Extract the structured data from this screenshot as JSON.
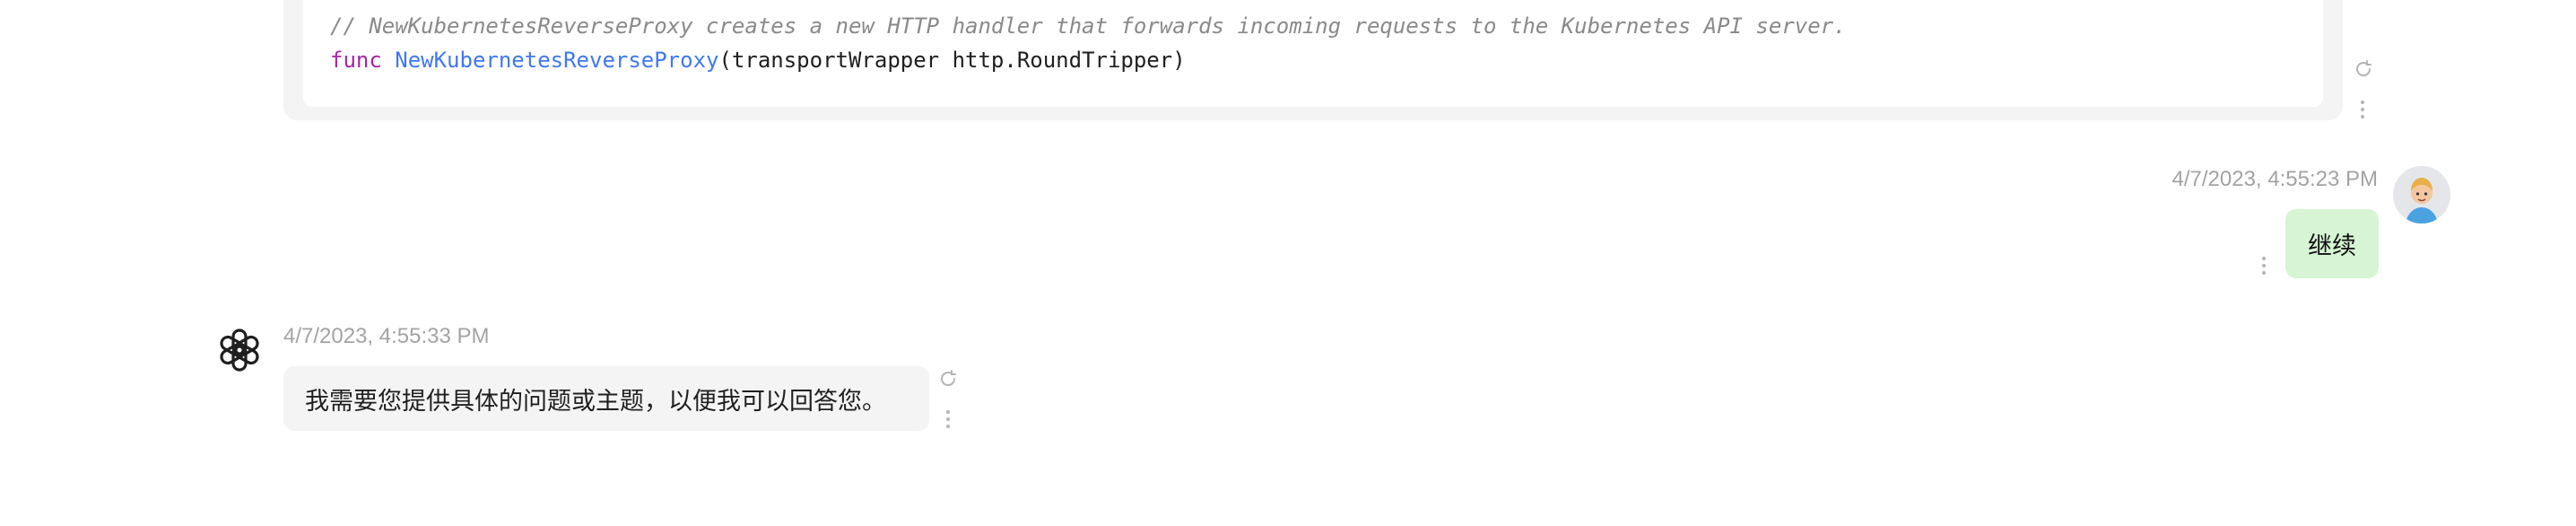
{
  "previous_message": {
    "code_comment": "// NewKubernetesReverseProxy creates a new HTTP handler that forwards incoming requests to the Kubernetes API server.",
    "code_keyword": "func",
    "code_function": "NewKubernetesReverseProxy",
    "code_params": "(transportWrapper http.RoundTripper)",
    "icons": [
      "refresh-icon",
      "more-vertical-icon"
    ]
  },
  "user_message": {
    "timestamp": "4/7/2023, 4:55:23 PM",
    "text": "继续",
    "avatar": "user-avatar",
    "icons": [
      "more-vertical-icon"
    ]
  },
  "assistant_message": {
    "timestamp": "4/7/2023, 4:55:33 PM",
    "text": "我需要您提供具体的问题或主题，以便我可以回答您。",
    "avatar": "openai-logo-icon",
    "icons": [
      "refresh-icon",
      "more-vertical-icon"
    ]
  },
  "colors": {
    "user_bubble": "#d7f5d4",
    "assistant_bubble": "#f4f4f4",
    "timestamp": "#a3a3a3",
    "code_keyword": "#a626a4",
    "code_function": "#4078f2",
    "code_comment": "#8a8a8a"
  }
}
